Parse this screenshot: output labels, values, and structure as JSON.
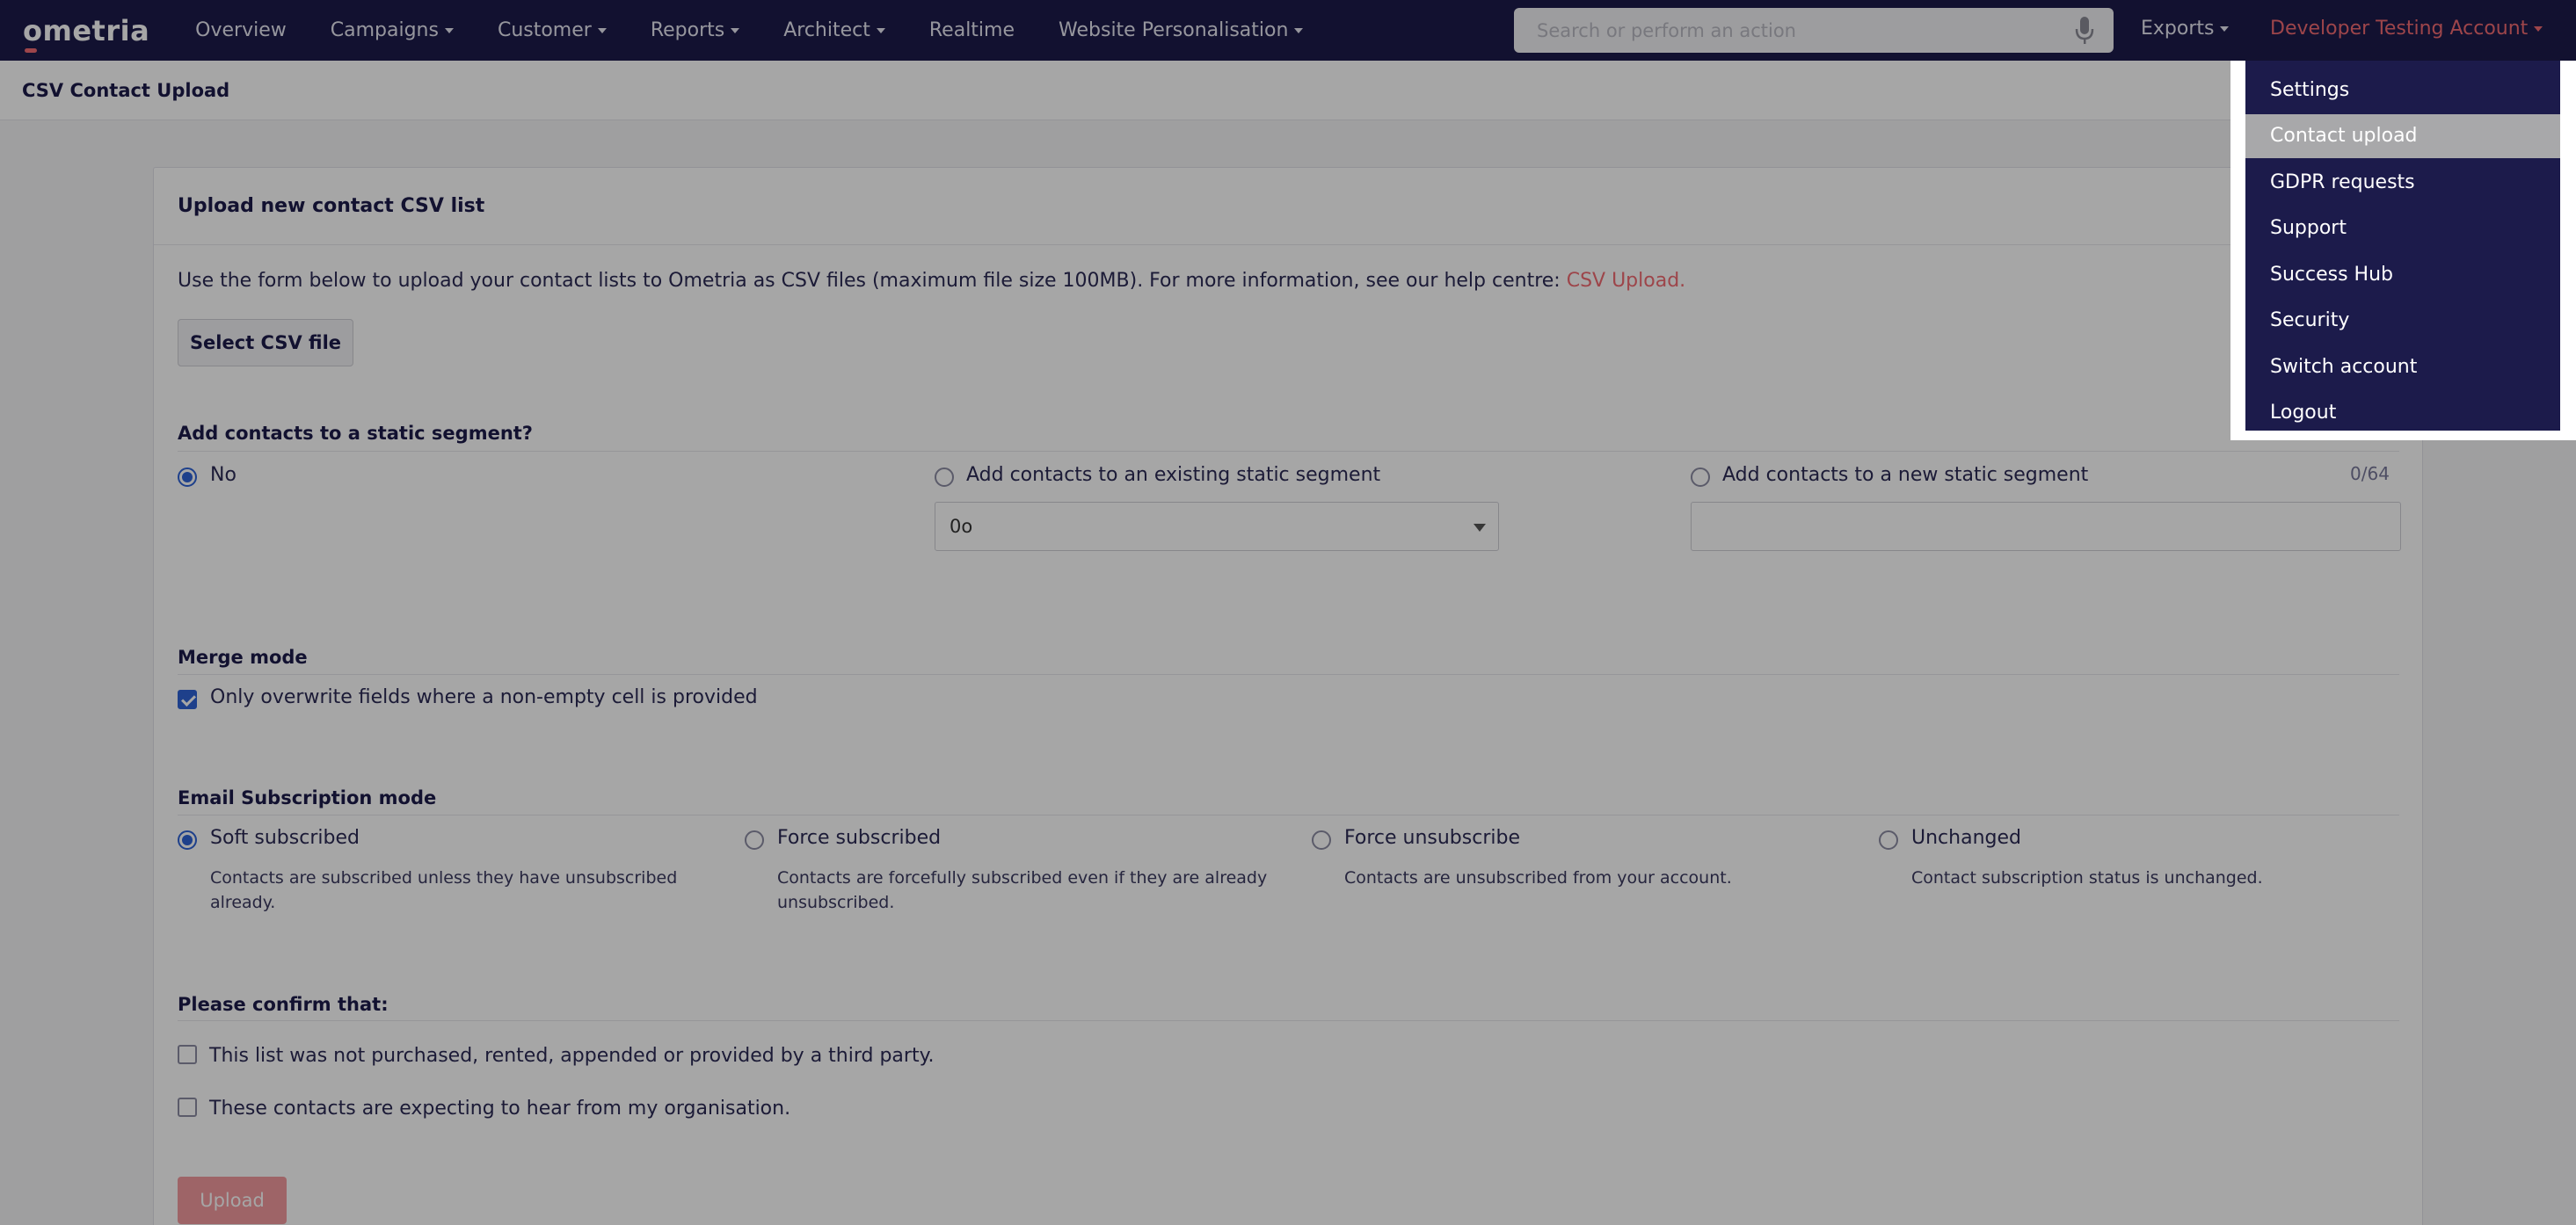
{
  "nav": {
    "logo": "ometria",
    "links": [
      {
        "label": "Overview",
        "caret": false
      },
      {
        "label": "Campaigns",
        "caret": true
      },
      {
        "label": "Customer",
        "caret": true
      },
      {
        "label": "Reports",
        "caret": true
      },
      {
        "label": "Architect",
        "caret": true
      },
      {
        "label": "Realtime",
        "caret": false
      },
      {
        "label": "Website Personalisation",
        "caret": true
      }
    ],
    "search_placeholder": "Search or perform an action",
    "exports": "Exports",
    "account": "Developer Testing Account"
  },
  "page": {
    "title": "CSV Contact Upload"
  },
  "card": {
    "title": "Upload new contact CSV list",
    "intro": "Use the form below to upload your contact lists to Ometria as CSV files (maximum file size 100MB). For more information, see our help centre: ",
    "intro_link": "CSV Upload.",
    "select_button": "Select CSV file",
    "segment": {
      "title": "Add contacts to a static segment?",
      "options": [
        "No",
        "Add contacts to an existing static segment",
        "Add contacts to a new static segment"
      ],
      "selected": "No",
      "existing_value": "0o",
      "new_counter": "0/64"
    },
    "merge": {
      "title": "Merge mode",
      "option": "Only overwrite fields where a non-empty cell is provided",
      "checked": true
    },
    "subscription": {
      "title": "Email Subscription mode",
      "options": [
        {
          "label": "Soft subscribed",
          "desc": "Contacts are subscribed unless they have unsubscribed already.",
          "selected": true
        },
        {
          "label": "Force subscribed",
          "desc": "Contacts are forcefully subscribed even if they are already unsubscribed.",
          "selected": false
        },
        {
          "label": "Force unsubscribe",
          "desc": "Contacts are unsubscribed from your account.",
          "selected": false
        },
        {
          "label": "Unchanged",
          "desc": "Contact subscription status is unchanged.",
          "selected": false
        }
      ]
    },
    "confirm": {
      "title": "Please confirm that:",
      "items": [
        "This list was not purchased, rented, appended or provided by a third party.",
        "These contacts are expecting to hear from my organisation."
      ]
    },
    "upload_button": "Upload"
  },
  "account_menu": {
    "items": [
      "Settings",
      "Contact upload",
      "GDPR requests",
      "Support",
      "Success Hub",
      "Security",
      "Switch account",
      "Logout"
    ],
    "active": "Contact upload"
  },
  "colors": {
    "nav_bg": "#1c1b4b",
    "accent": "#f16a72",
    "radio_blue": "#2f63d6"
  }
}
